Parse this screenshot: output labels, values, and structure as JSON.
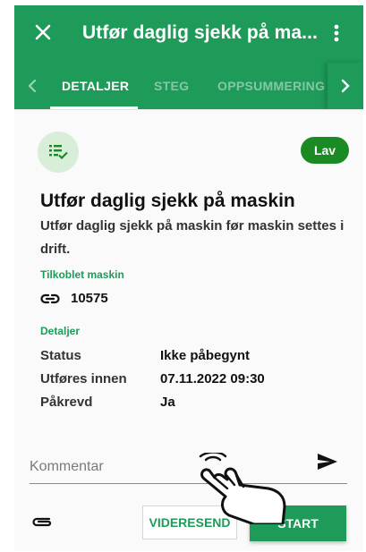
{
  "header": {
    "title": "Utfør daglig sjekk på ma...",
    "close_icon": "close-icon",
    "more_icon": "more-vert-icon"
  },
  "tabs": {
    "items": [
      {
        "label": "DETALJER",
        "active": true
      },
      {
        "label": "STEG",
        "active": false
      },
      {
        "label": "OPPSUMMERING",
        "active": false
      }
    ]
  },
  "task": {
    "icon": "checklist-icon",
    "priority": "Lav",
    "title": "Utfør daglig sjekk på maskin",
    "description": "Utfør daglig sjekk på maskin før maskin settes i drift."
  },
  "machine": {
    "label": "Tilkoblet maskin",
    "id": "10575",
    "icon": "link-icon"
  },
  "details": {
    "label": "Detaljer",
    "rows": [
      {
        "key": "Status",
        "value": "Ikke påbegynt"
      },
      {
        "key": "Utføres innen",
        "value": "07.11.2022 09:30"
      },
      {
        "key": "Påkrevd",
        "value": "Ja"
      }
    ]
  },
  "footer": {
    "comment_placeholder": "Kommentar",
    "forward_label": "VIDERESEND",
    "start_label": "START"
  },
  "colors": {
    "primary": "#1e9b59",
    "badge": "#1a8a24",
    "icon_bg": "#d8eed8"
  }
}
